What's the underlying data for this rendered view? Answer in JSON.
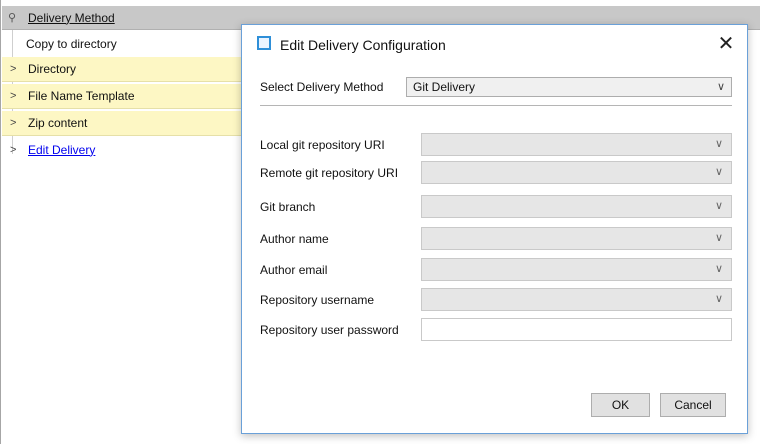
{
  "grid": {
    "header": {
      "label": "Delivery Method",
      "pin_icon": "pin-icon"
    },
    "rows": [
      {
        "label": "Copy to directory"
      },
      {
        "label": "Directory"
      },
      {
        "label": "File Name Template"
      },
      {
        "label": "Zip content"
      },
      {
        "label": "Edit Delivery"
      }
    ]
  },
  "dialog": {
    "title": "Edit Delivery Configuration",
    "close": "✕",
    "method_label": "Select Delivery Method",
    "method_value": "Git Delivery",
    "fields": [
      {
        "label": "Local git repository URI",
        "value": ""
      },
      {
        "label": "Remote git repository URI",
        "value": ""
      },
      {
        "label": "Git branch",
        "value": ""
      },
      {
        "label": "Author name",
        "value": ""
      },
      {
        "label": "Author email",
        "value": ""
      },
      {
        "label": "Repository username",
        "value": ""
      },
      {
        "label": "Repository user password",
        "value": ""
      }
    ],
    "ok_label": "OK",
    "cancel_label": "Cancel"
  },
  "colors": {
    "accent": "#2e8fd8",
    "row_highlight": "#fdf7c4",
    "link": "#0000ee"
  }
}
